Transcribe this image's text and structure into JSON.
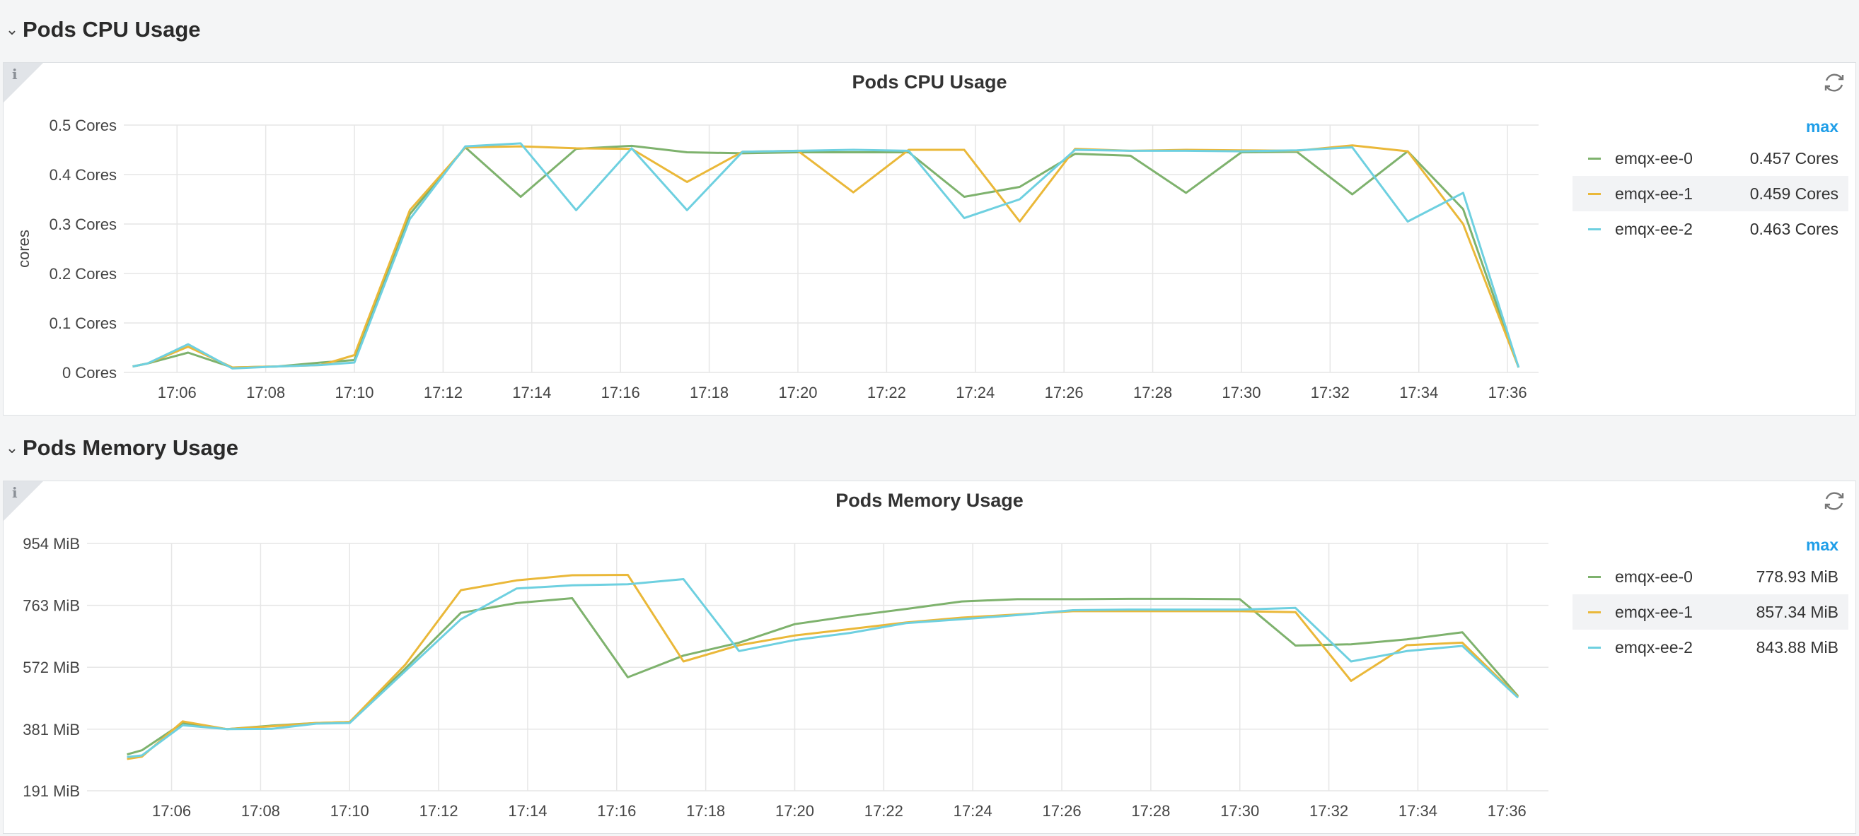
{
  "rows": [
    {
      "title": "Pods CPU Usage"
    },
    {
      "title": "Pods Memory Usage"
    }
  ],
  "panels": [
    {
      "title": "Pods CPU Usage",
      "info_icon": "info-icon",
      "refresh_icon": "refresh-icon"
    },
    {
      "title": "Pods Memory Usage",
      "info_icon": "info-icon",
      "refresh_icon": "refresh-icon"
    }
  ],
  "colors": {
    "emqx-ee-0": "#7eb26d",
    "emqx-ee-1": "#eab839",
    "emqx-ee-2": "#6ed0e0",
    "accent": "#1f9ee8"
  },
  "legend_cpu": {
    "header": "max",
    "items": [
      {
        "name": "emqx-ee-0",
        "value": "0.457 Cores"
      },
      {
        "name": "emqx-ee-1",
        "value": "0.459 Cores"
      },
      {
        "name": "emqx-ee-2",
        "value": "0.463 Cores"
      }
    ]
  },
  "legend_mem": {
    "header": "max",
    "items": [
      {
        "name": "emqx-ee-0",
        "value": "778.93 MiB"
      },
      {
        "name": "emqx-ee-1",
        "value": "857.34 MiB"
      },
      {
        "name": "emqx-ee-2",
        "value": "843.88 MiB"
      }
    ]
  },
  "chart_data": [
    {
      "type": "line",
      "title": "Pods CPU Usage",
      "ylabel": "cores",
      "ylim": [
        0,
        0.5
      ],
      "xlim": [
        "17:04:48",
        "17:36:42"
      ],
      "grid": true,
      "legend": "right",
      "yticks": [
        {
          "value": 0,
          "label": "0 Cores"
        },
        {
          "value": 0.1,
          "label": "0.1 Cores"
        },
        {
          "value": 0.2,
          "label": "0.2 Cores"
        },
        {
          "value": 0.3,
          "label": "0.3 Cores"
        },
        {
          "value": 0.4,
          "label": "0.4 Cores"
        },
        {
          "value": 0.5,
          "label": "0.5 Cores"
        }
      ],
      "xticks": [
        "17:06",
        "17:08",
        "17:10",
        "17:12",
        "17:14",
        "17:16",
        "17:18",
        "17:20",
        "17:22",
        "17:24",
        "17:26",
        "17:28",
        "17:30",
        "17:32",
        "17:34",
        "17:36"
      ],
      "series": [
        {
          "name": "emqx-ee-0",
          "color": "#7eb26d",
          "points": [
            [
              "17:05:00",
              0.012
            ],
            [
              "17:05:20",
              0.018
            ],
            [
              "17:06:15",
              0.04
            ],
            [
              "17:07:15",
              0.01
            ],
            [
              "17:08:15",
              0.012
            ],
            [
              "17:09:15",
              0.02
            ],
            [
              "17:10:00",
              0.025
            ],
            [
              "17:11:15",
              0.32
            ],
            [
              "17:12:30",
              0.455
            ],
            [
              "17:13:45",
              0.355
            ],
            [
              "17:15:00",
              0.452
            ],
            [
              "17:16:15",
              0.458
            ],
            [
              "17:17:30",
              0.445
            ],
            [
              "17:18:45",
              0.443
            ],
            [
              "17:20:00",
              0.445
            ],
            [
              "17:21:15",
              0.445
            ],
            [
              "17:22:30",
              0.445
            ],
            [
              "17:23:45",
              0.355
            ],
            [
              "17:25:00",
              0.375
            ],
            [
              "17:26:15",
              0.442
            ],
            [
              "17:27:30",
              0.438
            ],
            [
              "17:28:45",
              0.363
            ],
            [
              "17:30:00",
              0.445
            ],
            [
              "17:31:15",
              0.446
            ],
            [
              "17:32:30",
              0.36
            ],
            [
              "17:33:45",
              0.447
            ],
            [
              "17:35:00",
              0.33
            ],
            [
              "17:36:15",
              0.01
            ]
          ]
        },
        {
          "name": "emqx-ee-1",
          "color": "#eab839",
          "points": [
            [
              "17:05:00",
              0.012
            ],
            [
              "17:05:20",
              0.018
            ],
            [
              "17:06:15",
              0.052
            ],
            [
              "17:07:15",
              0.01
            ],
            [
              "17:08:15",
              0.012
            ],
            [
              "17:09:15",
              0.015
            ],
            [
              "17:10:00",
              0.035
            ],
            [
              "17:11:15",
              0.328
            ],
            [
              "17:12:30",
              0.455
            ],
            [
              "17:13:45",
              0.457
            ],
            [
              "17:15:00",
              0.453
            ],
            [
              "17:16:15",
              0.452
            ],
            [
              "17:17:30",
              0.385
            ],
            [
              "17:18:45",
              0.446
            ],
            [
              "17:20:00",
              0.448
            ],
            [
              "17:21:15",
              0.364
            ],
            [
              "17:22:30",
              0.45
            ],
            [
              "17:23:45",
              0.45
            ],
            [
              "17:25:00",
              0.305
            ],
            [
              "17:26:15",
              0.452
            ],
            [
              "17:27:30",
              0.448
            ],
            [
              "17:28:45",
              0.45
            ],
            [
              "17:30:00",
              0.449
            ],
            [
              "17:31:15",
              0.448
            ],
            [
              "17:32:30",
              0.459
            ],
            [
              "17:33:45",
              0.447
            ],
            [
              "17:35:00",
              0.3
            ],
            [
              "17:36:15",
              0.01
            ]
          ]
        },
        {
          "name": "emqx-ee-2",
          "color": "#6ed0e0",
          "points": [
            [
              "17:05:00",
              0.012
            ],
            [
              "17:05:20",
              0.018
            ],
            [
              "17:06:15",
              0.057
            ],
            [
              "17:07:15",
              0.008
            ],
            [
              "17:08:15",
              0.012
            ],
            [
              "17:09:15",
              0.015
            ],
            [
              "17:10:00",
              0.02
            ],
            [
              "17:11:15",
              0.31
            ],
            [
              "17:12:30",
              0.457
            ],
            [
              "17:13:45",
              0.463
            ],
            [
              "17:15:00",
              0.328
            ],
            [
              "17:16:15",
              0.453
            ],
            [
              "17:17:30",
              0.328
            ],
            [
              "17:18:45",
              0.446
            ],
            [
              "17:20:00",
              0.448
            ],
            [
              "17:21:15",
              0.45
            ],
            [
              "17:22:30",
              0.448
            ],
            [
              "17:23:45",
              0.312
            ],
            [
              "17:25:00",
              0.35
            ],
            [
              "17:26:15",
              0.45
            ],
            [
              "17:27:30",
              0.448
            ],
            [
              "17:28:45",
              0.448
            ],
            [
              "17:30:00",
              0.447
            ],
            [
              "17:31:15",
              0.449
            ],
            [
              "17:32:30",
              0.455
            ],
            [
              "17:33:45",
              0.305
            ],
            [
              "17:35:00",
              0.363
            ],
            [
              "17:36:15",
              0.01
            ]
          ]
        }
      ]
    },
    {
      "type": "line",
      "title": "Pods Memory Usage",
      "ylabel": "",
      "ylim": [
        191,
        954
      ],
      "xlim": [
        "17:04:06",
        "17:36:56"
      ],
      "grid": true,
      "legend": "right",
      "yticks": [
        {
          "value": 191,
          "label": "191 MiB"
        },
        {
          "value": 381,
          "label": "381 MiB"
        },
        {
          "value": 572,
          "label": "572 MiB"
        },
        {
          "value": 763,
          "label": "763 MiB"
        },
        {
          "value": 954,
          "label": "954 MiB"
        }
      ],
      "xticks": [
        "17:06",
        "17:08",
        "17:10",
        "17:12",
        "17:14",
        "17:16",
        "17:18",
        "17:20",
        "17:22",
        "17:24",
        "17:26",
        "17:28",
        "17:30",
        "17:32",
        "17:34",
        "17:36"
      ],
      "series": [
        {
          "name": "emqx-ee-0",
          "color": "#7eb26d",
          "points": [
            [
              "17:05:00",
              303
            ],
            [
              "17:05:20",
              316
            ],
            [
              "17:06:15",
              400
            ],
            [
              "17:07:15",
              381
            ],
            [
              "17:08:15",
              392
            ],
            [
              "17:09:15",
              400
            ],
            [
              "17:10:00",
              403
            ],
            [
              "17:11:15",
              568
            ],
            [
              "17:12:30",
              740
            ],
            [
              "17:13:45",
              770
            ],
            [
              "17:15:00",
              785
            ],
            [
              "17:16:15",
              541
            ],
            [
              "17:17:30",
              608
            ],
            [
              "17:18:45",
              648
            ],
            [
              "17:20:00",
              705
            ],
            [
              "17:21:15",
              730
            ],
            [
              "17:22:30",
              752
            ],
            [
              "17:23:45",
              775
            ],
            [
              "17:25:00",
              782
            ],
            [
              "17:26:15",
              782
            ],
            [
              "17:27:30",
              783
            ],
            [
              "17:28:45",
              783
            ],
            [
              "17:30:00",
              782
            ],
            [
              "17:31:15",
              639
            ],
            [
              "17:32:30",
              643
            ],
            [
              "17:33:45",
              658
            ],
            [
              "17:35:00",
              680
            ],
            [
              "17:36:15",
              483
            ]
          ]
        },
        {
          "name": "emqx-ee-1",
          "color": "#eab839",
          "points": [
            [
              "17:05:00",
              289
            ],
            [
              "17:05:20",
              296
            ],
            [
              "17:06:15",
              405
            ],
            [
              "17:07:15",
              381
            ],
            [
              "17:08:15",
              390
            ],
            [
              "17:09:15",
              400
            ],
            [
              "17:10:00",
              403
            ],
            [
              "17:11:15",
              580
            ],
            [
              "17:12:30",
              810
            ],
            [
              "17:13:45",
              840
            ],
            [
              "17:15:00",
              856
            ],
            [
              "17:16:15",
              857
            ],
            [
              "17:17:30",
              590
            ],
            [
              "17:18:45",
              640
            ],
            [
              "17:20:00",
              670
            ],
            [
              "17:21:15",
              690
            ],
            [
              "17:22:30",
              710
            ],
            [
              "17:23:45",
              725
            ],
            [
              "17:25:00",
              735
            ],
            [
              "17:26:15",
              745
            ],
            [
              "17:27:30",
              745
            ],
            [
              "17:28:45",
              745
            ],
            [
              "17:30:00",
              745
            ],
            [
              "17:31:15",
              742
            ],
            [
              "17:32:30",
              530
            ],
            [
              "17:33:45",
              640
            ],
            [
              "17:35:00",
              648
            ],
            [
              "17:36:15",
              480
            ]
          ]
        },
        {
          "name": "emqx-ee-2",
          "color": "#6ed0e0",
          "points": [
            [
              "17:05:00",
              295
            ],
            [
              "17:05:20",
              300
            ],
            [
              "17:06:15",
              393
            ],
            [
              "17:07:15",
              381
            ],
            [
              "17:08:15",
              382
            ],
            [
              "17:09:15",
              398
            ],
            [
              "17:10:00",
              400
            ],
            [
              "17:11:15",
              560
            ],
            [
              "17:12:30",
              720
            ],
            [
              "17:13:45",
              815
            ],
            [
              "17:15:00",
              825
            ],
            [
              "17:16:15",
              828
            ],
            [
              "17:17:30",
              844
            ],
            [
              "17:18:45",
              622
            ],
            [
              "17:20:00",
              656
            ],
            [
              "17:21:15",
              678
            ],
            [
              "17:22:30",
              708
            ],
            [
              "17:23:45",
              720
            ],
            [
              "17:25:00",
              733
            ],
            [
              "17:26:15",
              748
            ],
            [
              "17:27:30",
              750
            ],
            [
              "17:28:45",
              750
            ],
            [
              "17:30:00",
              750
            ],
            [
              "17:31:15",
              755
            ],
            [
              "17:32:30",
              590
            ],
            [
              "17:33:45",
              622
            ],
            [
              "17:35:00",
              638
            ],
            [
              "17:36:15",
              478
            ]
          ]
        }
      ]
    }
  ]
}
